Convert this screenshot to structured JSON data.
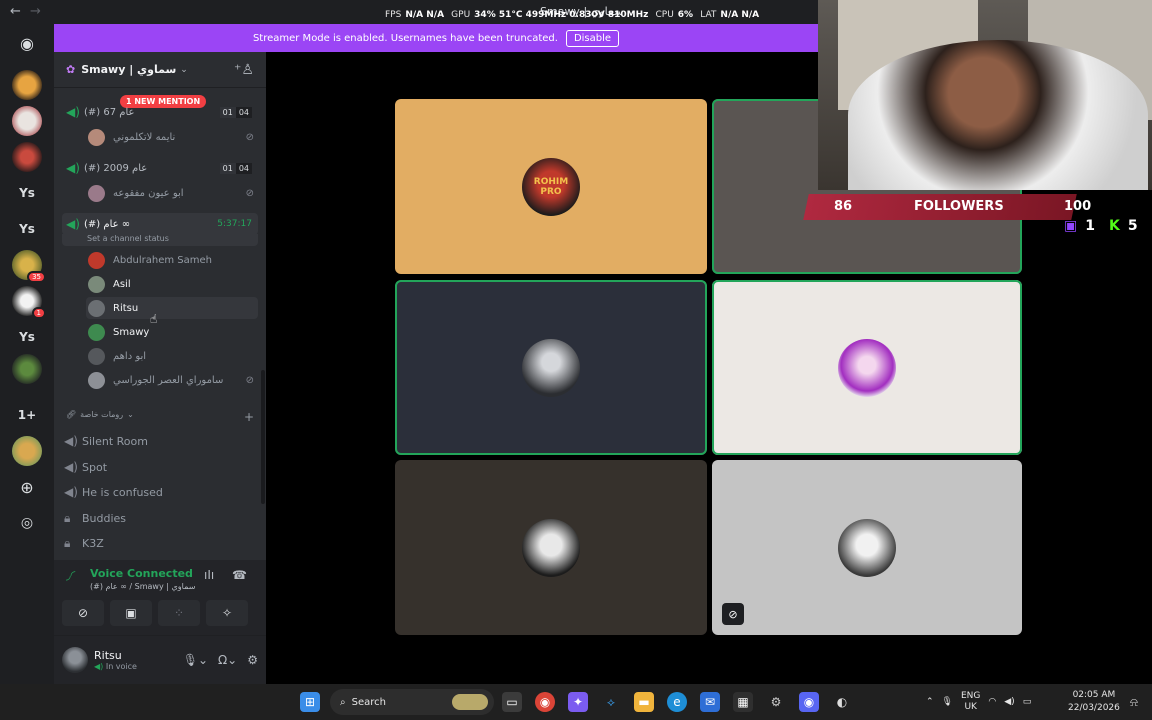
{
  "titlebar": {
    "title": "Smawy | سماوي"
  },
  "overlay": {
    "fps_label": "FPS",
    "fps_value": "N/A N/A",
    "gpu_label": "GPU",
    "gpu_value": "34% 51°C 499MHz 0.830V 810MHz",
    "cpu_label": "CPU",
    "cpu_value": "6%",
    "lat_label": "LAT",
    "lat_value": "N/A N/A"
  },
  "streamer_banner": {
    "text": "Streamer Mode is enabled. Usernames have been truncated.",
    "button": "Disable",
    "color": "#9b45f5"
  },
  "server_rail": {
    "items": [
      {
        "name": "discord-home",
        "glyph": "◉"
      },
      {
        "name": "server-1",
        "glyph": ""
      },
      {
        "name": "server-2",
        "glyph": ""
      },
      {
        "name": "server-3",
        "glyph": ""
      },
      {
        "name": "ys-1",
        "glyph": "Ys"
      },
      {
        "name": "ys-2",
        "glyph": "Ys"
      },
      {
        "name": "server-4",
        "glyph": "",
        "badge": "35"
      },
      {
        "name": "server-5",
        "glyph": "",
        "badge": "1"
      },
      {
        "name": "ys-3",
        "glyph": "Ys"
      },
      {
        "name": "server-6",
        "glyph": ""
      },
      {
        "name": "one-plus",
        "glyph": "1+"
      },
      {
        "name": "server-7",
        "glyph": ""
      },
      {
        "name": "add-server",
        "glyph": "+"
      },
      {
        "name": "discover",
        "glyph": "◎"
      }
    ]
  },
  "sidebar": {
    "server_name": "Smawy | سماوي",
    "mention_pill": "1 NEW MENTION",
    "voice_channels": [
      {
        "name": "(#) 67 عام",
        "count_a": "01",
        "count_b": "04"
      },
      {
        "name": "(#) 2009 عام",
        "count_a": "01",
        "count_b": "04"
      },
      {
        "name": "(#) عام ∞",
        "timer": "5:37:17"
      }
    ],
    "channel_status": "Set a channel status",
    "members_ch1": [
      {
        "name": "نايمه لاتكلموني"
      }
    ],
    "members_ch2": [
      {
        "name": "ابو عيون مفقوعه"
      }
    ],
    "members_ch3": [
      {
        "name": "Abdulrahem Sameh",
        "color": "#c0392b"
      },
      {
        "name": "Asil",
        "color": "#7a8a7a"
      },
      {
        "name": "Ritsu",
        "color": "#6b6f73"
      },
      {
        "name": "Smawy",
        "color": "#3e8a4f"
      },
      {
        "name": "ابو داهم",
        "color": "#55585c"
      },
      {
        "name": "ساموراي العصر الجوراسي",
        "color": "#8d9096"
      }
    ],
    "category": "رومات خاصة",
    "text_channels": [
      {
        "label": "Silent Room",
        "icon": "speaker"
      },
      {
        "label": "Spot",
        "icon": "speaker"
      },
      {
        "label": "He is confused",
        "icon": "speaker"
      },
      {
        "label": "Buddies",
        "icon": "lock"
      },
      {
        "label": "K3Z",
        "icon": "lock"
      }
    ]
  },
  "voice_panel": {
    "status": "Voice Connected",
    "channel": "(#) عام ∞ / Smawy | سماوي"
  },
  "user_panel": {
    "name": "Ritsu",
    "status": "In voice"
  },
  "stage": {
    "tiles": [
      {
        "name": "tile-1",
        "bg": "#e2ad63",
        "label": "ROHIM PRO",
        "speaking": false
      },
      {
        "name": "tile-2",
        "bg": "#5a5552",
        "speaking": true
      },
      {
        "name": "tile-3",
        "bg": "#2b2f3a",
        "speaking": true
      },
      {
        "name": "tile-4",
        "bg": "#ece8e4",
        "speaking": true
      },
      {
        "name": "tile-5",
        "bg": "#36312c",
        "speaking": false
      },
      {
        "name": "tile-6",
        "bg": "#c4c4c4",
        "speaking": false
      }
    ]
  },
  "stream_overlay": {
    "followers_count": "86",
    "followers_label": "FOLLOWERS",
    "followers_goal": "100",
    "twitch_count": "1",
    "kick_count": "5"
  },
  "taskbar": {
    "search": "Search",
    "lang_1": "ENG",
    "lang_2": "UK",
    "time": "02:05 AM",
    "date": "22/03/2026"
  }
}
